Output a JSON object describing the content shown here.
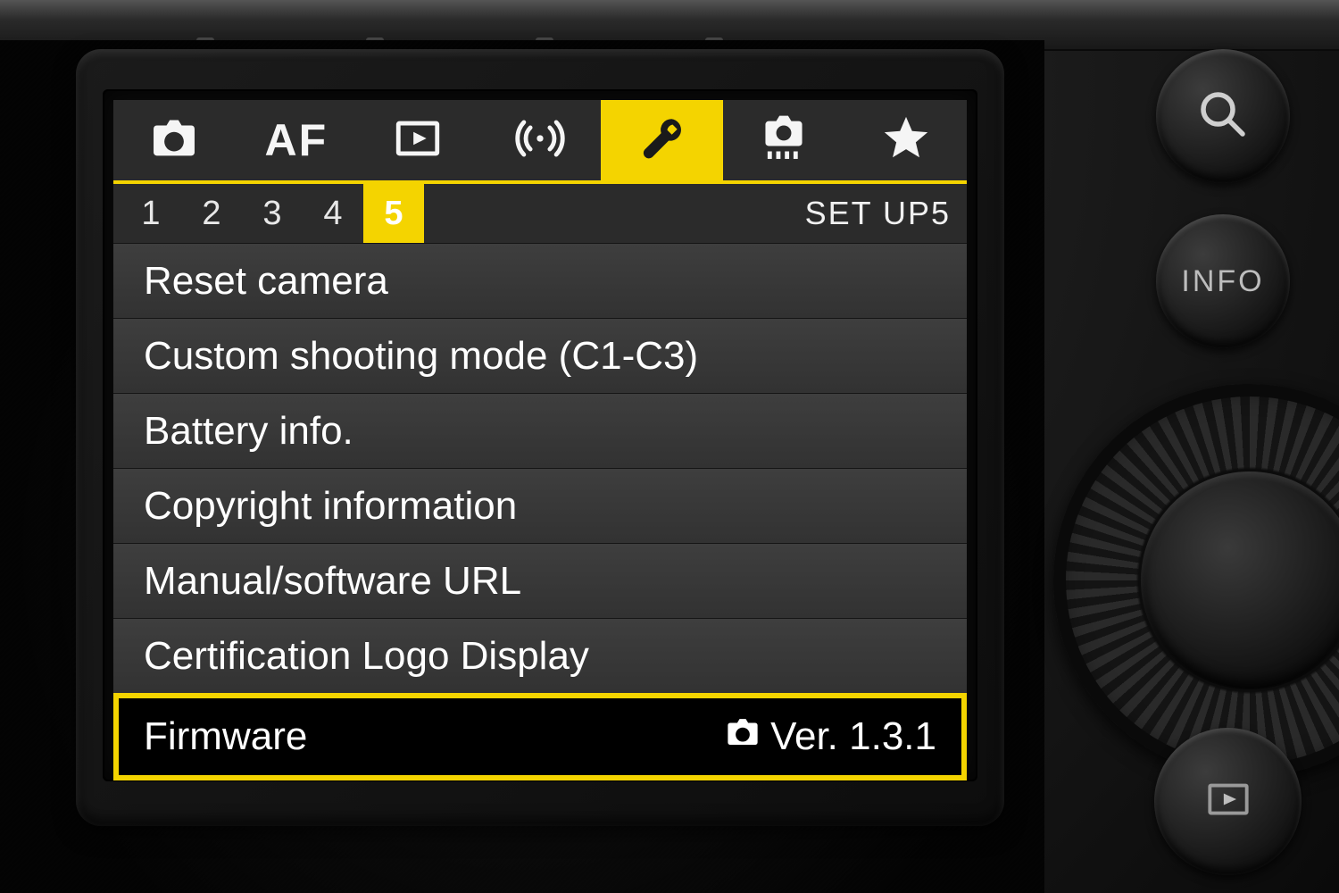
{
  "colors": {
    "accent": "#f4d400"
  },
  "tabs": [
    {
      "icon": "camera-icon"
    },
    {
      "icon": "af-text",
      "label": "AF"
    },
    {
      "icon": "playback-icon"
    },
    {
      "icon": "wireless-icon"
    },
    {
      "icon": "wrench-icon",
      "active": true
    },
    {
      "icon": "custom-fn-icon"
    },
    {
      "icon": "star-icon"
    }
  ],
  "pages": {
    "numbers": [
      "1",
      "2",
      "3",
      "4",
      "5"
    ],
    "active_index": 4,
    "breadcrumb": "SET UP5"
  },
  "menu": {
    "items": [
      {
        "label": "Reset camera"
      },
      {
        "label": "Custom shooting mode (C1-C3)"
      },
      {
        "label": "Battery info."
      },
      {
        "label": "Copyright information"
      },
      {
        "label": "Manual/software URL"
      },
      {
        "label": "Certification Logo Display"
      },
      {
        "label": "Firmware",
        "value_icon": "camera-icon",
        "value": "Ver. 1.3.1",
        "selected": true
      }
    ]
  },
  "hard_buttons": {
    "info_label": "INFO"
  }
}
